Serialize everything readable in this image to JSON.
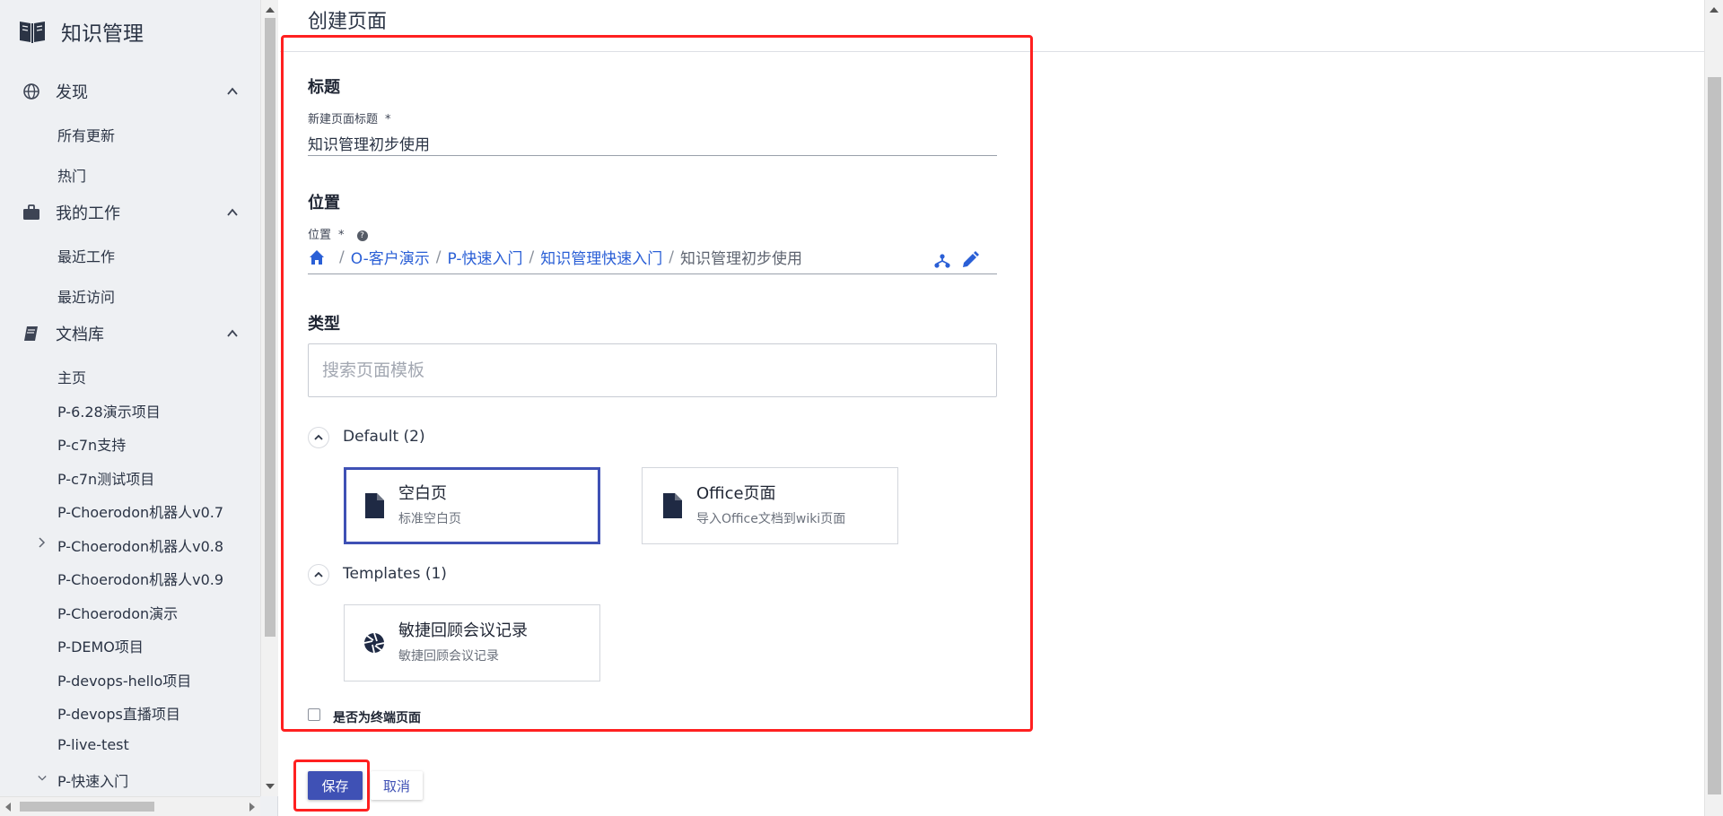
{
  "app": {
    "name": "知识管理",
    "logo_icon": "open-book-icon"
  },
  "sidebar": {
    "groups": [
      {
        "label": "发现",
        "icon": "globe-icon",
        "items": [
          "所有更新",
          "热门"
        ]
      },
      {
        "label": "我的工作",
        "icon": "briefcase-icon",
        "items": [
          "最近工作",
          "最近访问"
        ]
      },
      {
        "label": "文档库",
        "icon": "book-icon",
        "items": [
          "主页",
          "P-6.28演示项目",
          "P-c7n支持",
          "P-c7n测试项目",
          "P-Choerodon机器人v0.7",
          "P-Choerodon机器人v0.8",
          "P-Choerodon机器人v0.9",
          "P-Choerodon演示",
          "P-DEMO项目",
          "P-devops-hello项目",
          "P-devops直播项目",
          "P-live-test",
          "P-快速入门"
        ]
      }
    ]
  },
  "page": {
    "title": "创建页面",
    "title_section": {
      "heading": "标题",
      "field_label": "新建页面标题",
      "required_mark": "*",
      "value": "知识管理初步使用"
    },
    "location_section": {
      "heading": "位置",
      "field_label": "位置",
      "required_mark": "*",
      "help_icon": "?",
      "breadcrumb": {
        "separator": "/",
        "links": [
          "O-客户演示",
          "P-快速入门",
          "知识管理快速入门"
        ],
        "current": "知识管理初步使用"
      }
    },
    "type_section": {
      "heading": "类型",
      "search_placeholder": "搜索页面模板",
      "groups": [
        {
          "label": "Default (2)",
          "cards": [
            {
              "title": "空白页",
              "desc": "标准空白页",
              "icon": "document-icon",
              "selected": true
            },
            {
              "title": "Office页面",
              "desc": "导入Office文档到wiki页面",
              "icon": "document-icon",
              "selected": false
            }
          ]
        },
        {
          "label": "Templates (1)",
          "cards": [
            {
              "title": "敏捷回顾会议记录",
              "desc": "敏捷回顾会议记录",
              "icon": "aperture-icon",
              "selected": false
            }
          ]
        }
      ]
    },
    "terminal_checkbox_label": "是否为终端页面",
    "actions": {
      "save": "保存",
      "cancel": "取消"
    }
  },
  "colors": {
    "primary": "#3f51b5",
    "link": "#2a5fd6",
    "highlight_box": "#ff2020",
    "sidebar_bg": "#eef0f3"
  }
}
